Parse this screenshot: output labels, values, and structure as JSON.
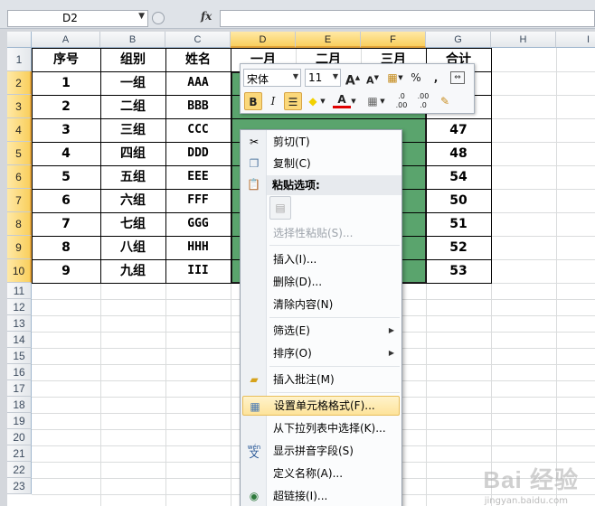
{
  "formula_bar": {
    "name_box": "D2",
    "fx_label": "fx",
    "formula": ""
  },
  "columns": [
    "A",
    "B",
    "C",
    "D",
    "E",
    "F",
    "G",
    "H",
    "I"
  ],
  "rows": [
    "1",
    "2",
    "3",
    "4",
    "5",
    "6",
    "7",
    "8",
    "9",
    "10",
    "11",
    "12",
    "13",
    "14",
    "15",
    "16",
    "17",
    "18",
    "19",
    "20",
    "21",
    "22",
    "23"
  ],
  "table": {
    "header": [
      "序号",
      "组别",
      "姓名",
      "一月",
      "二月",
      "三月",
      "合计"
    ],
    "body": [
      [
        "1",
        "一组",
        "AAA",
        "",
        "",
        "",
        ""
      ],
      [
        "2",
        "二组",
        "BBB",
        "",
        "",
        "",
        ""
      ],
      [
        "3",
        "三组",
        "CCC",
        "",
        "",
        "",
        "47"
      ],
      [
        "4",
        "四组",
        "DDD",
        "",
        "",
        "",
        "48"
      ],
      [
        "5",
        "五组",
        "EEE",
        "",
        "",
        "",
        "54"
      ],
      [
        "6",
        "六组",
        "FFF",
        "",
        "",
        "",
        "50"
      ],
      [
        "7",
        "七组",
        "GGG",
        "",
        "",
        "",
        "51"
      ],
      [
        "8",
        "八组",
        "HHH",
        "",
        "",
        "",
        "52"
      ],
      [
        "9",
        "九组",
        "III",
        "",
        "",
        "",
        "53"
      ]
    ]
  },
  "mini_toolbar": {
    "font_name": "宋体",
    "font_size": "11",
    "grow_font": "A",
    "shrink_font": "A",
    "percent": "%",
    "comma": ",",
    "bold": "B",
    "italic": "I",
    "font_color": "A",
    "inc_decimal": ".0 .00",
    "dec_decimal": ".00 .0"
  },
  "context_menu": {
    "cut": "剪切(T)",
    "copy": "复制(C)",
    "paste_options": "粘贴选项:",
    "paste_special": "选择性粘贴(S)...",
    "insert": "插入(I)...",
    "delete": "删除(D)...",
    "clear": "清除内容(N)",
    "filter": "筛选(E)",
    "sort": "排序(O)",
    "insert_comment": "插入批注(M)",
    "format_cells": "设置单元格格式(F)...",
    "pick_list": "从下拉列表中选择(K)...",
    "phonetic": "显示拼音字段(S)",
    "define_name": "定义名称(A)...",
    "hyperlink": "超链接(I)...",
    "phonetic_icon_text": "wén",
    "phonetic_icon_char": "文"
  },
  "watermark": {
    "brand": "Bai 经验",
    "url": "jingyan.baidu.com"
  },
  "colors": {
    "selection": "#5aa46d",
    "header_selected": "#f9cf5e",
    "menu_highlight": "#fde39a"
  }
}
